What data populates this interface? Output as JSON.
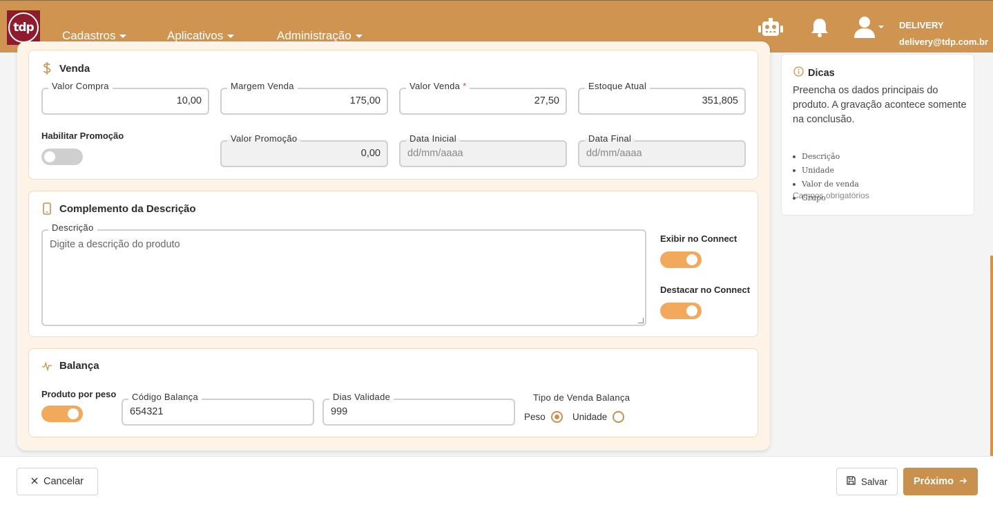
{
  "logo": {
    "text": "tdp"
  },
  "nav": {
    "items": [
      {
        "label": "Cadastros"
      },
      {
        "label": "Aplicativos"
      },
      {
        "label": "Administração"
      }
    ]
  },
  "user": {
    "name": "DELIVERY",
    "email": "delivery@tdp.com.br"
  },
  "venda": {
    "title": "Venda",
    "valor_compra": {
      "label": "Valor Compra",
      "value": "10,00"
    },
    "margem_venda": {
      "label": "Margem Venda",
      "value": "175,00"
    },
    "valor_venda": {
      "label": "Valor Venda",
      "required": "*",
      "value": "27,50"
    },
    "estoque_atual": {
      "label": "Estoque Atual",
      "value": "351,805"
    },
    "habilitar_promocao": {
      "label": "Habilitar Promoção",
      "on": false
    },
    "valor_promocao": {
      "label": "Valor Promoção",
      "value": "0,00"
    },
    "data_inicial": {
      "label": "Data Inicial",
      "placeholder": "dd/mm/aaaa"
    },
    "data_final": {
      "label": "Data Final",
      "placeholder": "dd/mm/aaaa"
    }
  },
  "complemento": {
    "title": "Complemento da Descrição",
    "descricao": {
      "label": "Descrição",
      "placeholder": "Digite a descrição do produto"
    },
    "exibir_connect": {
      "label": "Exibir no Connect",
      "on": true
    },
    "destacar_connect": {
      "label": "Destacar no Connect",
      "on": true
    }
  },
  "balanca": {
    "title": "Balança",
    "produto_por_peso": {
      "label": "Produto por peso",
      "on": true
    },
    "codigo_balanca": {
      "label": "Código Balança",
      "value": "654321"
    },
    "dias_validade": {
      "label": "Dias Validade",
      "value": "999"
    },
    "tipo_venda": {
      "label": "Tipo de Venda Balança",
      "options": [
        {
          "label": "Peso",
          "checked": true
        },
        {
          "label": "Unidade",
          "checked": false
        }
      ]
    }
  },
  "tips": {
    "title": "Dicas",
    "body": "Preencha os dados principais do produto. A gravação acontece somente na conclusão.",
    "required_title": "Campos obrigatórios",
    "required_fields": [
      "Descrição",
      "Unidade",
      "Valor de venda",
      "Grupo"
    ]
  },
  "footer": {
    "cancel_label": "Cancelar",
    "save_label": "Salvar",
    "next_label": "Próximo"
  },
  "colors": {
    "brand": "#cf9550",
    "accent": "#f2a95c",
    "logo_bg": "#8e1c2c"
  }
}
